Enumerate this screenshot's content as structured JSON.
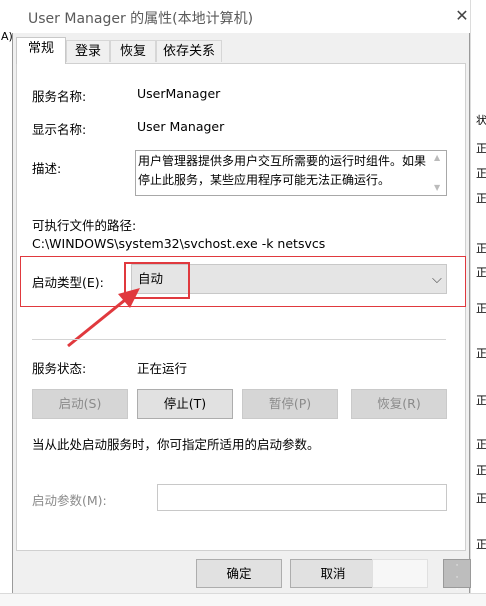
{
  "background": {
    "left_fragment": "A)",
    "right_fragments": [
      "状",
      "正",
      "正",
      "正",
      "正",
      "正",
      "正",
      "正",
      "正",
      "正",
      "正",
      "正",
      "正"
    ]
  },
  "dialog": {
    "title": "User Manager 的属性(本地计算机)"
  },
  "tabs": [
    {
      "label": "常规",
      "active": true
    },
    {
      "label": "登录",
      "active": false
    },
    {
      "label": "恢复",
      "active": false
    },
    {
      "label": "依存关系",
      "active": false
    }
  ],
  "general": {
    "service_name_label": "服务名称:",
    "service_name_value": "UserManager",
    "display_name_label": "显示名称:",
    "display_name_value": "User Manager",
    "description_label": "描述:",
    "description_value": "用户管理器提供多用户交互所需要的运行时组件。如果停止此服务，某些应用程序可能无法正确运行。",
    "exe_path_label": "可执行文件的路径:",
    "exe_path_value": "C:\\WINDOWS\\system32\\svchost.exe -k netsvcs",
    "startup_type_label": "启动类型(E):",
    "startup_type_value": "自动",
    "status_label": "服务状态:",
    "status_value": "正在运行",
    "start_button": "启动(S)",
    "stop_button": "停止(T)",
    "pause_button": "暂停(P)",
    "resume_button": "恢复(R)",
    "hint_text": "当从此处启动服务时，你可指定所适用的启动参数。",
    "start_params_label": "启动参数(M):",
    "start_params_value": ""
  },
  "footer": {
    "ok_button": "确定",
    "cancel_button": "取消",
    "apply_button": ""
  },
  "colors": {
    "annotation_red": "#e0393e",
    "dialog_bg": "#f0f0f0",
    "panel_bg": "#ffffff"
  }
}
